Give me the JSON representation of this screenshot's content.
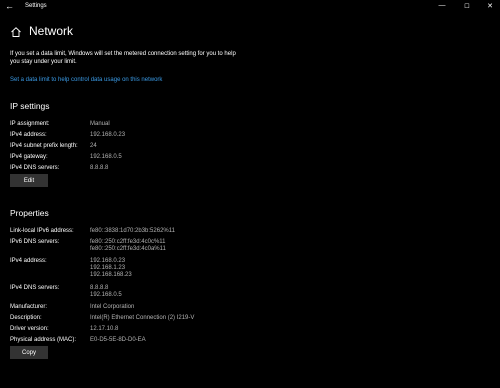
{
  "titlebar": {
    "back_glyph": "←",
    "title": "Settings",
    "min_glyph": "—",
    "max_glyph": "☐",
    "close_glyph": "✕"
  },
  "header": {
    "icon": "home-icon",
    "title": "Network"
  },
  "description": "If you set a data limit, Windows will set the metered connection setting for you to help you stay under your limit.",
  "link_text": "Set a data limit to help control data usage on this network",
  "ip_settings": {
    "title": "IP settings",
    "rows": [
      {
        "label": "IP assignment:",
        "value": "Manual"
      },
      {
        "label": "IPv4 address:",
        "value": "192.168.0.23"
      },
      {
        "label": "IPv4 subnet prefix length:",
        "value": "24"
      },
      {
        "label": "IPv4 gateway:",
        "value": "192.168.0.5"
      },
      {
        "label": "IPv4 DNS servers:",
        "value": "8.8.8.8"
      }
    ],
    "edit_label": "Edit"
  },
  "properties": {
    "title": "Properties",
    "rows": [
      {
        "label": "Link-local IPv6 address:",
        "value": "fe80::3838:1d70:2b3b:5262%11"
      },
      {
        "label": "IPv6 DNS servers:",
        "value": "fe80::250:c2ff:fe3d:4c0c%11\nfe80::250:c2ff:fe3d:4c0a%11"
      },
      {
        "label": "IPv4 address:",
        "value": "192.168.0.23\n192.168.1.23\n192.168.168.23"
      },
      {
        "label": "IPv4 DNS servers:",
        "value": "8.8.8.8\n192.168.0.5"
      },
      {
        "label": "Manufacturer:",
        "value": "Intel Corporation"
      },
      {
        "label": "Description:",
        "value": "Intel(R) Ethernet Connection (2) I219-V"
      },
      {
        "label": "Driver version:",
        "value": "12.17.10.8"
      },
      {
        "label": "Physical address (MAC):",
        "value": "E0-D5-5E-8D-D0-EA"
      }
    ],
    "copy_label": "Copy"
  },
  "colors": {
    "background": "#000000",
    "link": "#3a9ae5",
    "value_text": "#b3b3b3",
    "button_bg": "#333333"
  }
}
